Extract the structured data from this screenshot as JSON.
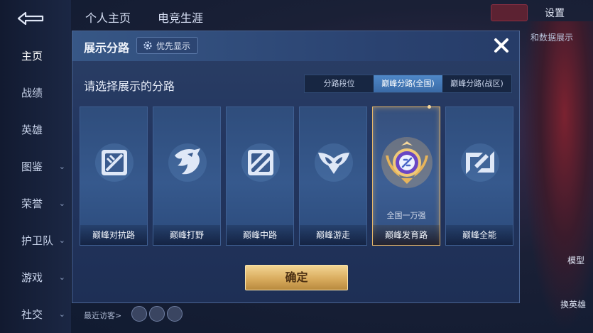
{
  "background": {
    "nav_items": [
      {
        "label": "主页",
        "active": true,
        "chevron": false
      },
      {
        "label": "战绩",
        "active": false,
        "chevron": false
      },
      {
        "label": "英雄",
        "active": false,
        "chevron": false
      },
      {
        "label": "图鉴",
        "active": false,
        "chevron": true
      },
      {
        "label": "荣誉",
        "active": false,
        "chevron": true
      },
      {
        "label": "护卫队",
        "active": false,
        "chevron": true
      },
      {
        "label": "游戏",
        "active": false,
        "chevron": true
      },
      {
        "label": "社交",
        "active": false,
        "chevron": true
      }
    ],
    "top_tabs": [
      "个人主页",
      "电竞生涯"
    ],
    "settings_label": "设置",
    "data_show_label": "和数据展示",
    "model_label": "模型",
    "swap_hero_label": "换英雄",
    "visitors_label": "最近访客>"
  },
  "dialog": {
    "title": "展示分路",
    "priority_label": "优先显示",
    "prompt": "请选择展示的分路",
    "tabs": [
      {
        "label": "分路段位",
        "active": false
      },
      {
        "label": "巅峰分路(全国)",
        "active": true
      },
      {
        "label": "巅峰分路(战区)",
        "active": false
      }
    ],
    "cards": [
      {
        "label": "巅峰对抗路",
        "icon": "clash-lane-icon",
        "rank": "",
        "selected": false
      },
      {
        "label": "巅峰打野",
        "icon": "jungle-icon",
        "rank": "",
        "selected": false
      },
      {
        "label": "巅峰中路",
        "icon": "mid-lane-icon",
        "rank": "",
        "selected": false
      },
      {
        "label": "巅峰游走",
        "icon": "roam-icon",
        "rank": "",
        "selected": false
      },
      {
        "label": "巅峰发育路",
        "icon": "farm-lane-medal-icon",
        "rank": "全国一万强",
        "selected": true
      },
      {
        "label": "巅峰全能",
        "icon": "all-round-icon",
        "rank": "",
        "selected": false
      }
    ],
    "confirm_label": "确定"
  },
  "colors": {
    "accent_gold": "#e5b66a",
    "tab_active": "#4f88c8"
  }
}
